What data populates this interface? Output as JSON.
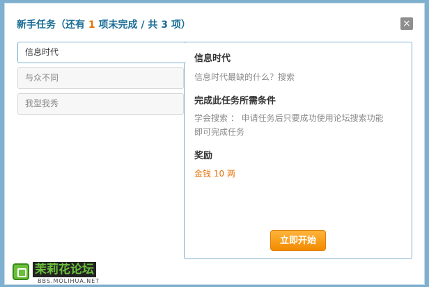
{
  "dialog": {
    "title_prefix": "新手任务（还有 ",
    "remaining": "1",
    "title_suffix": " 项未完成 / 共 3 项）",
    "close_label": "×"
  },
  "tabs": [
    {
      "label": "信息时代",
      "active": true
    },
    {
      "label": "与众不同",
      "active": false
    },
    {
      "label": "我型我秀",
      "active": false
    }
  ],
  "panel": {
    "title": "信息时代",
    "description": "信息时代最缺的什么？搜索",
    "condition_heading": "完成此任务所需条件",
    "condition_text_line1": "学会搜索 ： 申请任务后只要成功使用论坛搜索功能",
    "condition_text_line2": "即可完成任务",
    "reward_heading": "奖励",
    "reward_text": "金钱 10 两",
    "start_button": "立即开始"
  },
  "logo": {
    "name": "茉莉花论坛",
    "url": "BBS.MOLIHUA.NET"
  }
}
